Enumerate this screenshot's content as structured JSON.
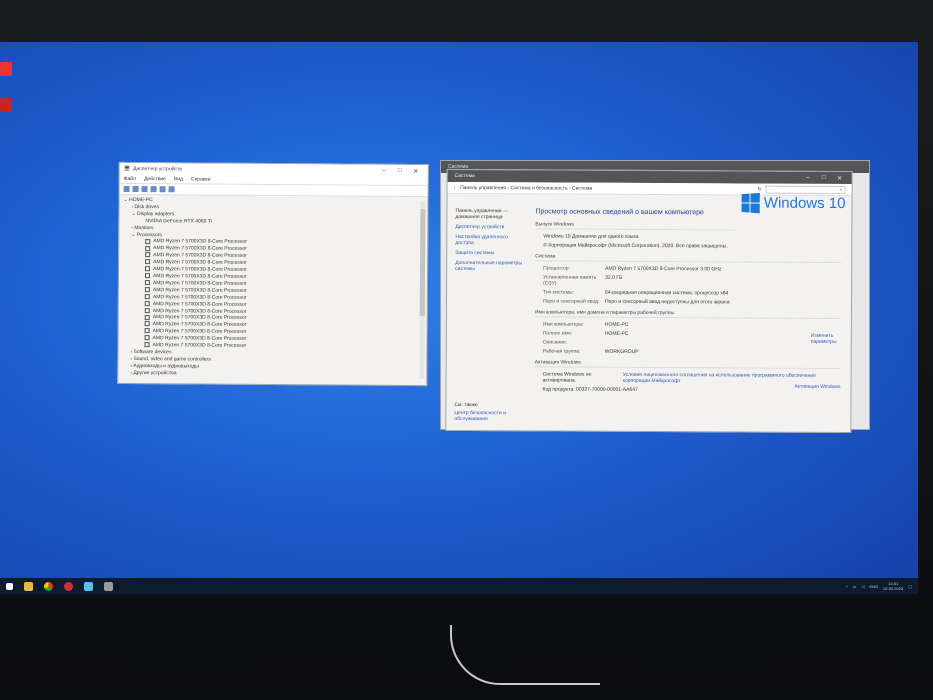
{
  "device_manager": {
    "title": "Диспетчер устройств",
    "menu": [
      "Файл",
      "Действие",
      "Вид",
      "Справка"
    ],
    "root": "HOME-PC",
    "categories": {
      "disk": "Disk drives",
      "display": "Display adapters",
      "gpu": "NVIDIA GeForce RTX 4060 Ti",
      "monitors": "Monitors",
      "processors": "Processors"
    },
    "processors": [
      "AMD Ryzen 7 5700X3D 8-Core Processor",
      "AMD Ryzen 7 5700X3D 8-Core Processor",
      "AMD Ryzen 7 5700X3D 8-Core Processor",
      "AMD Ryzen 7 5700X3D 8-Core Processor",
      "AMD Ryzen 7 5700X3D 8-Core Processor",
      "AMD Ryzen 7 5700X3D 8-Core Processor",
      "AMD Ryzen 7 5700X3D 8-Core Processor",
      "AMD Ryzen 7 5700X3D 8-Core Processor",
      "AMD Ryzen 7 5700X3D 8-Core Processor",
      "AMD Ryzen 7 5700X3D 8-Core Processor",
      "AMD Ryzen 7 5700X3D 8-Core Processor",
      "AMD Ryzen 7 5700X3D 8-Core Processor",
      "AMD Ryzen 7 5700X3D 8-Core Processor",
      "AMD Ryzen 7 5700X3D 8-Core Processor",
      "AMD Ryzen 7 5700X3D 8-Core Processor",
      "AMD Ryzen 7 5700X3D 8-Core Processor"
    ],
    "after": [
      "Software devices",
      "Sound, video and game controllers",
      "Аудиовходы и аудиовыходы",
      "Другие устройства"
    ]
  },
  "system": {
    "title": "Система",
    "breadcrumb": "Панель управления  ›  Система и безопасность  ›  Система",
    "left_home": "Панель управления — домашняя страница",
    "left_links": [
      "Диспетчер устройств",
      "Настройка удаленного доступа",
      "Защита системы",
      "Дополнительные параметры системы"
    ],
    "see_also": "См. также",
    "security_center": "Центр безопасности и обслуживания",
    "heading": "Просмотр основных сведений о вашем компьютере",
    "edition_section": "Выпуск Windows",
    "edition": "Windows 10 Домашняя для одного языка",
    "copyright": "© Корпорация Майкрософт (Microsoft Corporation), 2020. Все права защищены.",
    "logo_text": "Windows 10",
    "system_section": "Система",
    "specs": [
      {
        "k": "Процессор:",
        "v": "AMD Ryzen 7 5700X3D 8-Core Processor     3.00 GHz"
      },
      {
        "k": "Установленная память (ОЗУ):",
        "v": "32,0 ГБ"
      },
      {
        "k": "Тип системы:",
        "v": "64-разрядная операционная система, процессор x64"
      },
      {
        "k": "Перо и сенсорный ввод:",
        "v": "Перо и сенсорный ввод недоступны для этого экрана"
      }
    ],
    "name_section": "Имя компьютера, имя домена и параметры рабочей группы",
    "names": [
      {
        "k": "Имя компьютера:",
        "v": "HOME-PC"
      },
      {
        "k": "Полное имя:",
        "v": "HOME-PC"
      },
      {
        "k": "Описание:",
        "v": ""
      },
      {
        "k": "Рабочая группа:",
        "v": "WORKGROUP"
      }
    ],
    "change_settings": "Изменить параметры",
    "activation_section": "Активация Windows",
    "activation_status": "Система Windows не активирована.",
    "license_link": "Условия лицензионного соглашения на использование программного обеспечения корпорации Майкрософт",
    "product_key": "Код продукта: 00327-70000-00001-AA647",
    "activate": "Активация Windows"
  },
  "taskbar": {
    "lang": "ENG",
    "time": "13:31",
    "date": "02.02.2025"
  }
}
